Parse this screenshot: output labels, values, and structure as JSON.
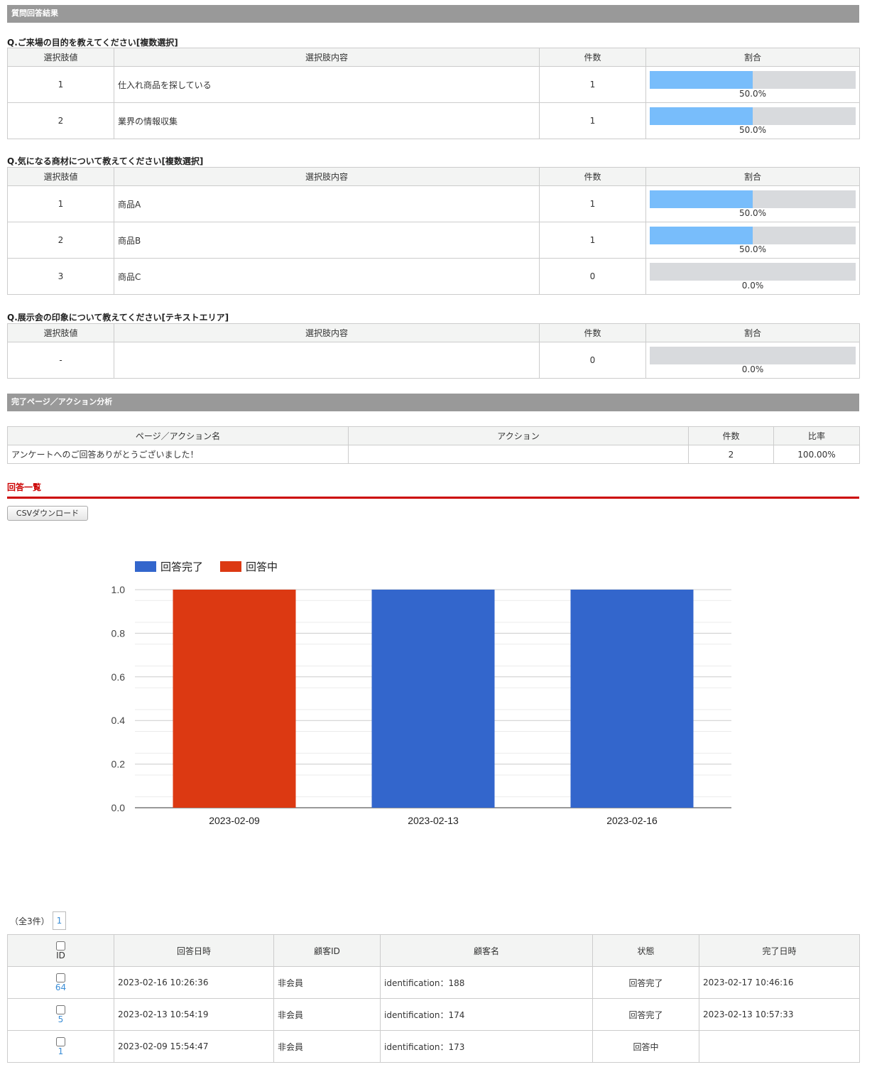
{
  "section1_title": "質問回答結果",
  "headers": {
    "value": "選択肢値",
    "content": "選択肢内容",
    "count": "件数",
    "ratio": "割合"
  },
  "questions": [
    {
      "title": "Q.ご来場の目的を教えてください[複数選択]",
      "rows": [
        {
          "value": "1",
          "content": "仕入れ商品を探している",
          "count": "1",
          "ratio": 50.0,
          "pct": "50.0%"
        },
        {
          "value": "2",
          "content": "業界の情報収集",
          "count": "1",
          "ratio": 50.0,
          "pct": "50.0%"
        }
      ]
    },
    {
      "title": "Q.気になる商材について教えてください[複数選択]",
      "rows": [
        {
          "value": "1",
          "content": "商品A",
          "count": "1",
          "ratio": 50.0,
          "pct": "50.0%"
        },
        {
          "value": "2",
          "content": "商品B",
          "count": "1",
          "ratio": 50.0,
          "pct": "50.0%"
        },
        {
          "value": "3",
          "content": "商品C",
          "count": "0",
          "ratio": 0,
          "pct": "0.0%"
        }
      ]
    },
    {
      "title": "Q.展示会の印象について教えてください[テキストエリア]",
      "rows": [
        {
          "value": "-",
          "content": "",
          "count": "0",
          "ratio": 0,
          "pct": "0.0%"
        }
      ]
    }
  ],
  "section2_title": "完了ページ／アクション分析",
  "action_table": {
    "headers": {
      "name": "ページ／アクション名",
      "action": "アクション",
      "count": "件数",
      "rate": "比率"
    },
    "rows": [
      {
        "name": "アンケートへのご回答ありがとうございました！",
        "action": "",
        "count": "2",
        "rate": "100.00%"
      }
    ]
  },
  "answers_title": "回答一覧",
  "csv_button": "CSVダウンロード",
  "colors": {
    "complete": "#3366cc",
    "in_progress": "#dc3912"
  },
  "chart_data": {
    "type": "bar",
    "categories": [
      "2023-02-09",
      "2023-02-13",
      "2023-02-16"
    ],
    "series": [
      {
        "name": "回答完了",
        "values": [
          0,
          1,
          1
        ]
      },
      {
        "name": "回答中",
        "values": [
          1,
          0,
          0
        ]
      }
    ],
    "ylim": [
      0,
      1.0
    ],
    "yticks": [
      "0.0",
      "0.2",
      "0.4",
      "0.6",
      "0.8",
      "1.0"
    ],
    "legend": "top-left",
    "grid": true
  },
  "pager": {
    "info": "（全3件）",
    "page": "1"
  },
  "list": {
    "headers": {
      "id": "ID",
      "answered_at": "回答日時",
      "customer_id": "顧客ID",
      "customer_name": "顧客名",
      "status": "状態",
      "completed_at": "完了日時"
    },
    "rows": [
      {
        "id": "64",
        "answered_at": "2023-02-16 10:26:36",
        "customer_id": "非会員",
        "customer_name": "identification：188",
        "status": "回答完了",
        "completed_at": "2023-02-17 10:46:16"
      },
      {
        "id": "5",
        "answered_at": "2023-02-13 10:54:19",
        "customer_id": "非会員",
        "customer_name": "identification：174",
        "status": "回答完了",
        "completed_at": "2023-02-13 10:57:33"
      },
      {
        "id": "1",
        "answered_at": "2023-02-09 15:54:47",
        "customer_id": "非会員",
        "customer_name": "identification：173",
        "status": "回答中",
        "completed_at": ""
      }
    ]
  }
}
